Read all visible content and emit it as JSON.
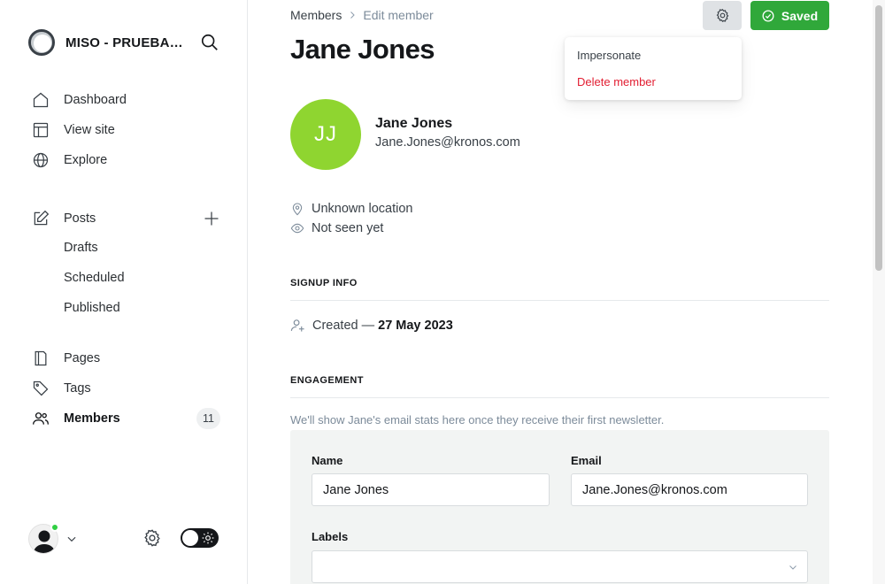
{
  "sidebar": {
    "site_name": "MISO - PRUEBA…",
    "nav": {
      "dashboard": "Dashboard",
      "view_site": "View site",
      "explore": "Explore",
      "posts": "Posts",
      "drafts": "Drafts",
      "scheduled": "Scheduled",
      "published": "Published",
      "pages": "Pages",
      "tags": "Tags",
      "members": "Members"
    },
    "members_count": "11"
  },
  "header": {
    "breadcrumb_parent": "Members",
    "breadcrumb_current": "Edit member",
    "saved_label": "Saved"
  },
  "menu": {
    "impersonate": "Impersonate",
    "delete": "Delete member"
  },
  "member": {
    "title": "Jane Jones",
    "initials": "JJ",
    "name": "Jane Jones",
    "email": "Jane.Jones@kronos.com",
    "location": "Unknown location",
    "seen": "Not seen yet",
    "avatar_color": "#8fd530"
  },
  "signup": {
    "heading": "SIGNUP INFO",
    "created_label": "Created —",
    "created_date": "27 May 2023"
  },
  "engagement": {
    "heading": "ENGAGEMENT",
    "note": "We'll show Jane's email stats here once they receive their first newsletter."
  },
  "form": {
    "name_label": "Name",
    "name_value": "Jane Jones",
    "email_label": "Email",
    "email_value": "Jane.Jones@kronos.com",
    "labels_label": "Labels",
    "labels_value": ""
  },
  "colors": {
    "accent_green": "#30a83a",
    "danger": "#e21e32"
  }
}
